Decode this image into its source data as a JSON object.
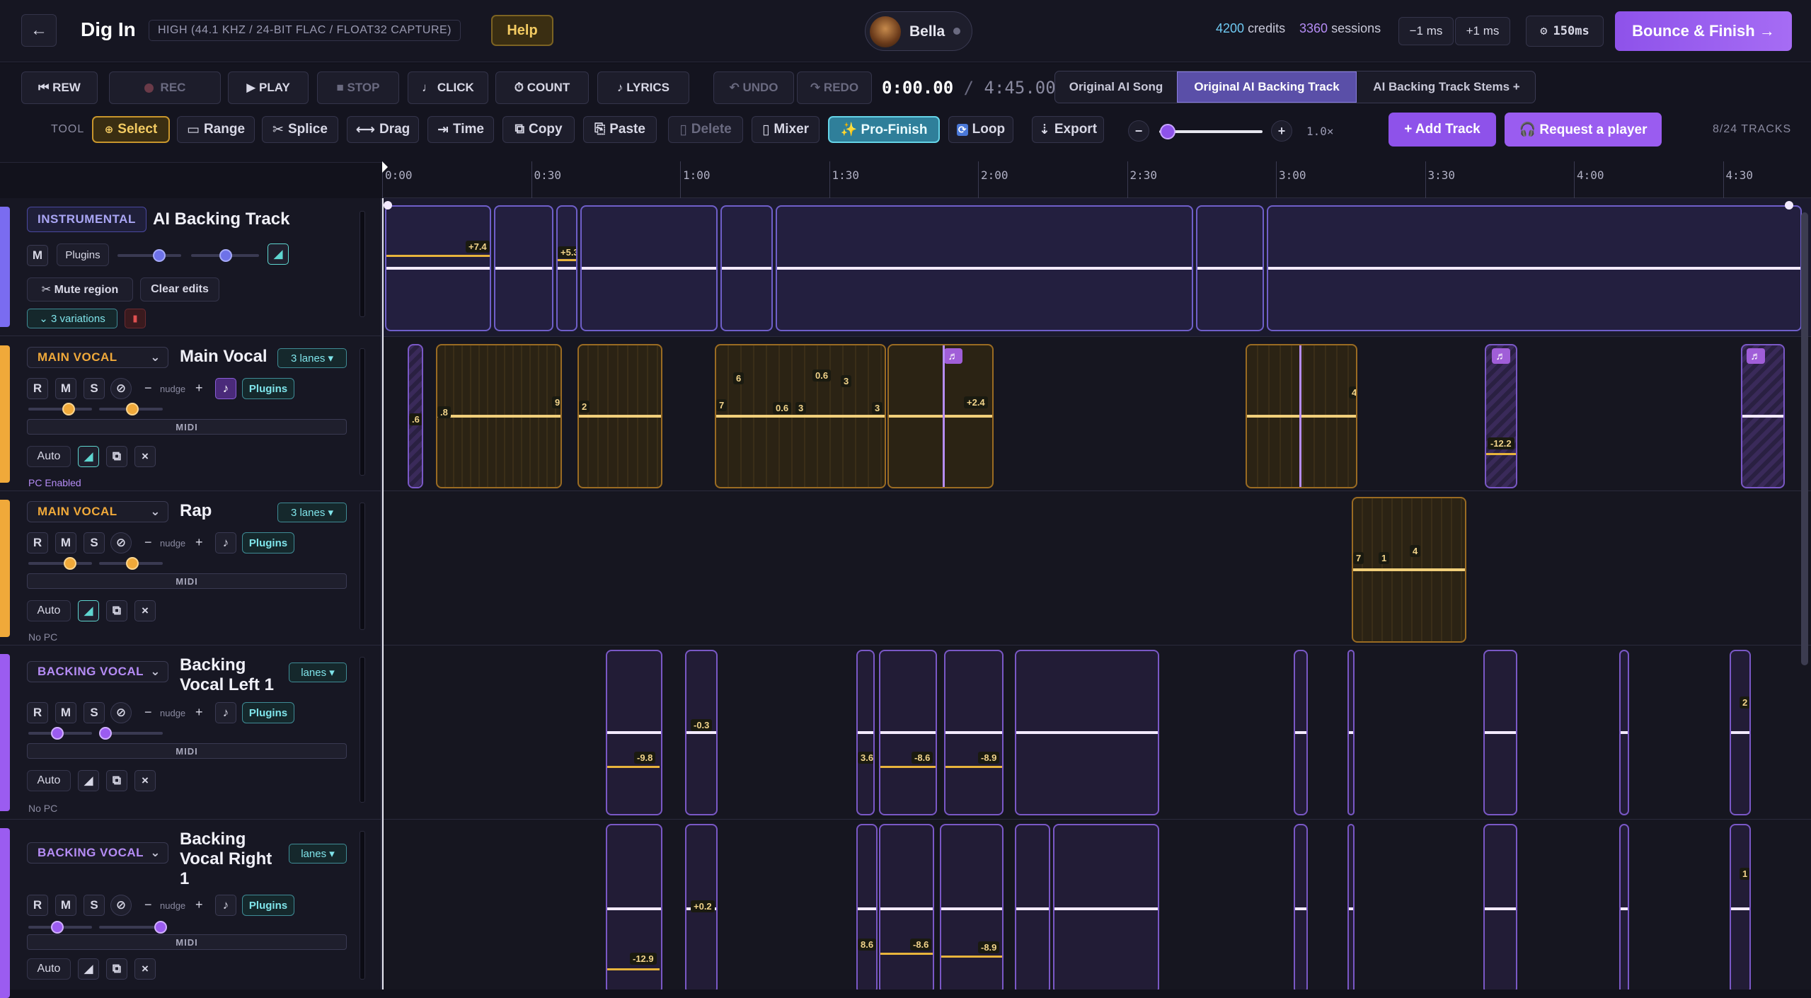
{
  "header": {
    "back_icon": "arrow-left-icon",
    "title": "Dig In",
    "quality": "HIGH (44.1 KHZ / 24-BIT FLAC / FLOAT32 CAPTURE)",
    "help": "Help",
    "user": "Bella",
    "credits_value": "4200",
    "credits_label": "credits",
    "sessions_value": "3360",
    "sessions_label": "sessions",
    "minus_ms": "−1 ms",
    "plus_ms": "+1 ms",
    "latency": "150ms",
    "bounce": "Bounce & Finish →"
  },
  "transport": {
    "rew": "⏮ REW",
    "rec": "REC",
    "play": "▶ PLAY",
    "stop": "■ STOP",
    "click": "♩ CLICK",
    "count": "⏱ COUNT",
    "lyrics": "♪ LYRICS",
    "undo": "↶ UNDO",
    "redo": "↷ REDO",
    "time_current": "0:00.00",
    "time_sep": "/",
    "time_total": "4:45.00",
    "source_tabs": [
      "Original AI Song",
      "Original AI Backing Track",
      "AI Backing Track Stems +"
    ]
  },
  "tools": {
    "label": "TOOL",
    "select": "Select",
    "range": "Range",
    "splice": "Splice",
    "drag": "Drag",
    "time": "Time",
    "copy": "Copy",
    "paste": "Paste",
    "delete": "Delete",
    "mixer": "Mixer",
    "pro_finish": "✨ Pro-Finish",
    "loop": "Loop",
    "export": "Export",
    "zoom_minus": "−",
    "zoom_plus": "+",
    "zoom_value": "1.0×",
    "zoom_fraction": 0.08,
    "add_track": "+ Add Track",
    "request_player": "🎧 Request a player",
    "track_count": "8/24 TRACKS"
  },
  "ruler": {
    "ticks": [
      "0:00",
      "0:30",
      "1:00",
      "1:30",
      "2:00",
      "2:30",
      "3:00",
      "3:30",
      "4:00",
      "4:30"
    ]
  },
  "tracks": [
    {
      "tag": "INSTRUMENTAL",
      "name": "AI Backing Track",
      "m": "M",
      "plugins": "Plugins",
      "mute_region": "✂ Mute region",
      "clear_edits": "Clear edits",
      "variations": "⌄ 3 variations",
      "gains": [
        "+7.4",
        "+5.3"
      ]
    },
    {
      "tag": "MAIN VOCAL",
      "name": "Main Vocal",
      "lanes": "3 lanes ▾",
      "r": "R",
      "m": "M",
      "s": "S",
      "nudge_minus": "−",
      "nudge": "nudge",
      "nudge_plus": "+",
      "plugins": "Plugins",
      "midi": "MIDI",
      "auto": "Auto",
      "close": "×",
      "pc": "PC Enabled",
      "gains": [
        ".6",
        ".8",
        "9",
        "2",
        "6",
        "0.6",
        "3",
        "0.6",
        "3",
        "7",
        "3",
        "+2.4",
        "4",
        "-12.2"
      ]
    },
    {
      "tag": "MAIN VOCAL",
      "name": "Rap",
      "lanes": "3 lanes ▾",
      "r": "R",
      "m": "M",
      "s": "S",
      "nudge_minus": "−",
      "nudge": "nudge",
      "nudge_plus": "+",
      "plugins": "Plugins",
      "midi": "MIDI",
      "auto": "Auto",
      "close": "×",
      "pc": "No PC",
      "gains": [
        "7",
        "1",
        "4"
      ]
    },
    {
      "tag": "BACKING VOCAL",
      "name_line1": "Backing",
      "name_line2": "Vocal Left 1",
      "lanes": "lanes ▾",
      "r": "R",
      "m": "M",
      "s": "S",
      "nudge_minus": "−",
      "nudge": "nudge",
      "nudge_plus": "+",
      "plugins": "Plugins",
      "midi": "MIDI",
      "auto": "Auto",
      "close": "×",
      "pc": "No PC",
      "gains": [
        "-9.8",
        "-0.3",
        "3.6",
        "-8.6",
        "-8.9",
        "2"
      ]
    },
    {
      "tag": "BACKING VOCAL",
      "name_line1": "Backing",
      "name_line2": "Vocal Right",
      "name_line3": "1",
      "lanes": "lanes ▾",
      "r": "R",
      "m": "M",
      "s": "S",
      "nudge_minus": "−",
      "nudge": "nudge",
      "nudge_plus": "+",
      "plugins": "Plugins",
      "midi": "MIDI",
      "auto": "Auto",
      "close": "×",
      "gains": [
        "-12.9",
        "+0.2",
        "8.6",
        "-8.6",
        "-8.9",
        "1"
      ]
    }
  ],
  "colors": {
    "accent_purple": "#9b5cf0",
    "accent_orange": "#f0a93a",
    "accent_teal": "#5fd6d0",
    "instrumental_wave": "#9a8cf0",
    "vocal_wave": "#e9b24a",
    "backing_wave": "#b889f5"
  }
}
